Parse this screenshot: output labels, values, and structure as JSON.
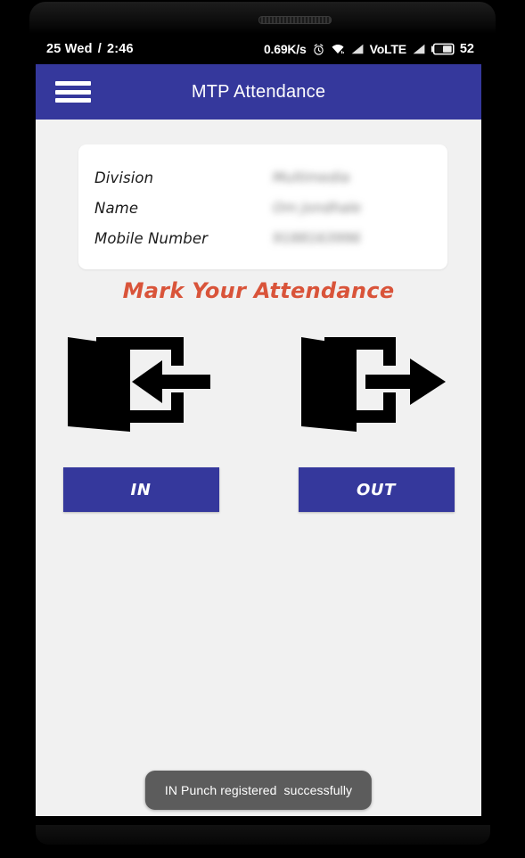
{
  "status_bar": {
    "date": "25 Wed",
    "separator": "/",
    "time": "2:46",
    "network_speed": "0.69K/s",
    "alarm_icon": "alarm-clock-icon",
    "wifi_icon": "wifi-icon",
    "signal_icon": "signal-bars-icon",
    "volte_label": "VoLTE",
    "signal2_icon": "signal-bars-icon",
    "battery_icon": "battery-icon",
    "battery_level": "52"
  },
  "app_bar": {
    "menu_icon": "hamburger-menu-icon",
    "title": "MTP Attendance",
    "background_color": "#35389c",
    "title_color": "#ffffff"
  },
  "info_card": {
    "rows": [
      {
        "label": "Division",
        "value": "Multimedia"
      },
      {
        "label": "Name",
        "value": "Om Jondhale"
      },
      {
        "label": "Mobile Number",
        "value": "9188163996"
      }
    ]
  },
  "main": {
    "heading": "Mark Your Attendance",
    "heading_color": "#d9543a",
    "actions": [
      {
        "icon": "door-enter-icon",
        "label": "IN"
      },
      {
        "icon": "door-exit-icon",
        "label": "OUT"
      }
    ],
    "button_color": "#35389c"
  },
  "toast": {
    "message": "IN Punch registered  successfully",
    "background_color": "#5c5c5c"
  }
}
